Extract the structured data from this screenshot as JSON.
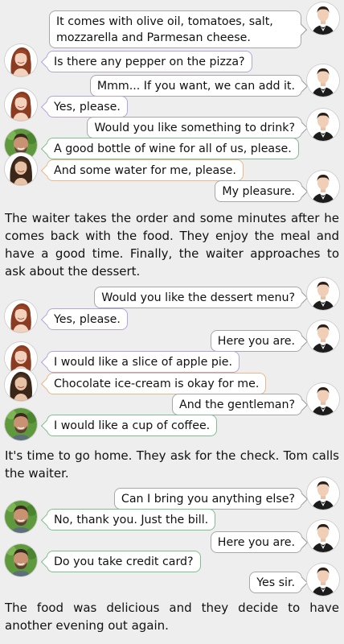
{
  "colors": {
    "background": "#eeeeee",
    "waiter_border": "#a7a7a7",
    "woman_border": "#b3a4dc",
    "man_border": "#7fbf8e",
    "girl_border": "#e8b78a"
  },
  "avatars": {
    "waiter": "waiter-avatar-icon",
    "woman": "red-haired-woman-avatar-icon",
    "man": "bearded-man-avatar-icon",
    "girl": "dark-haired-woman-avatar-icon"
  },
  "messages": [
    {
      "speaker": "waiter",
      "text": "It comes with olive oil, tomatoes, salt, mozzarella and Parmesan cheese."
    },
    {
      "speaker": "woman",
      "text": "Is there any pepper on the pizza?"
    },
    {
      "speaker": "waiter",
      "text": "Mmm... If you want, we can add it."
    },
    {
      "speaker": "woman",
      "text": "Yes, please."
    },
    {
      "speaker": "waiter",
      "text": "Would you like something to drink?"
    },
    {
      "speaker": "man",
      "text": "A good bottle of wine for all of us, please."
    },
    {
      "speaker": "girl",
      "text": "And some water for me, please."
    },
    {
      "speaker": "waiter",
      "text": "My pleasure."
    },
    {
      "speaker": "waiter",
      "text": "Would you like the dessert menu?"
    },
    {
      "speaker": "woman",
      "text": "Yes, please."
    },
    {
      "speaker": "waiter",
      "text": "Here you are."
    },
    {
      "speaker": "woman",
      "text": "I would like a slice of apple pie."
    },
    {
      "speaker": "girl",
      "text": "Chocolate ice-cream is okay for me."
    },
    {
      "speaker": "waiter",
      "text": "And the gentleman?"
    },
    {
      "speaker": "man",
      "text": "I would like a cup of coffee."
    },
    {
      "speaker": "waiter",
      "text": "Can I bring you anything else?"
    },
    {
      "speaker": "man",
      "text": "No, thank you. Just the bill."
    },
    {
      "speaker": "waiter",
      "text": "Here you are."
    },
    {
      "speaker": "man",
      "text": "Do you take credit card?"
    },
    {
      "speaker": "waiter",
      "text": "Yes sir."
    }
  ],
  "narration": [
    "The waiter takes the order and some minutes after he comes back with the food. They enjoy the meal and have a good time. Finally, the waiter approaches to ask about the dessert.",
    "It's time to go home. They ask for the check. Tom calls the waiter.",
    "The food was delicious and they decide to have another evening out again."
  ]
}
